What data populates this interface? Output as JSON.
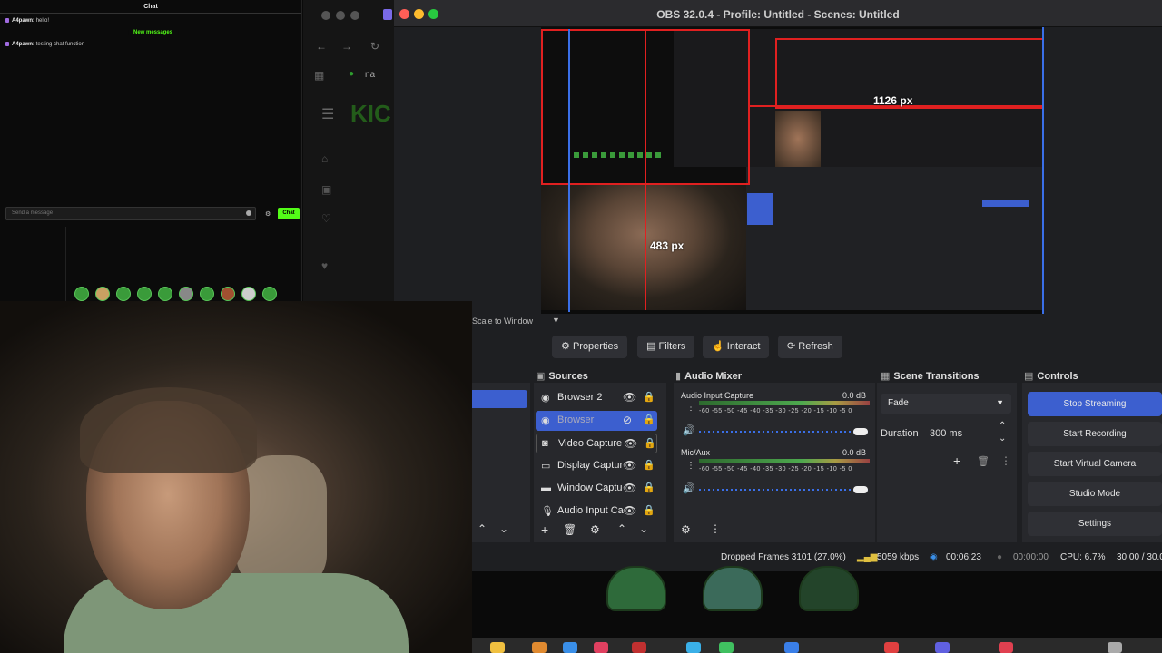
{
  "chat": {
    "title": "Chat",
    "messages": [
      {
        "user": "A4pawn:",
        "text": "hello!"
      },
      {
        "user": "A4pawn:",
        "text": "testing chat function"
      }
    ],
    "divider": "New messages",
    "input_placeholder": "Send a message",
    "send_label": "Chat"
  },
  "browser": {
    "tab_text": "na",
    "logo": "KIC"
  },
  "obs": {
    "title": "OBS 32.0.4 - Profile: Untitled - Scenes: Untitled",
    "preview": {
      "width_label": "1126 px",
      "height_label": "483 px"
    },
    "scale_label": "Scale to Window",
    "toolbar": {
      "properties": "Properties",
      "filters": "Filters",
      "interact": "Interact",
      "refresh": "Refresh"
    },
    "panels": {
      "sources": "Sources",
      "audio_mixer": "Audio Mixer",
      "scene_transitions": "Scene Transitions",
      "controls": "Controls"
    },
    "sources": [
      {
        "name": "Browser 2"
      },
      {
        "name": "Browser"
      },
      {
        "name": "Video Capture"
      },
      {
        "name": "Display Captur"
      },
      {
        "name": "Window Captu"
      },
      {
        "name": "Audio Input Ca"
      }
    ],
    "mixer": [
      {
        "name": "Audio Input Capture",
        "db": "0.0 dB",
        "level": 0.0
      },
      {
        "name": "Mic/Aux",
        "db": "0.0 dB",
        "level": 0.0
      }
    ],
    "mixer_ticks": "-60  -55  -50  -45  -40  -35  -30  -25  -20  -15  -10   -5    0",
    "transitions": {
      "selected": "Fade",
      "duration_label": "Duration",
      "duration_value": "300 ms"
    },
    "controls": {
      "stop_streaming": "Stop Streaming",
      "start_recording": "Start Recording",
      "start_virtual_camera": "Start Virtual Camera",
      "studio_mode": "Studio Mode",
      "settings": "Settings"
    },
    "status": {
      "dropped_frames": "Dropped Frames 3101 (27.0%)",
      "bitrate": "5059 kbps",
      "stream_time": "00:06:23",
      "record_time": "00:00:00",
      "cpu": "CPU: 6.7%",
      "fps": "30.00 / 30.0"
    }
  },
  "colors": {
    "accent_blue": "#3c5fcf",
    "kick_green": "#53fc18",
    "selection_red": "#e02020"
  }
}
